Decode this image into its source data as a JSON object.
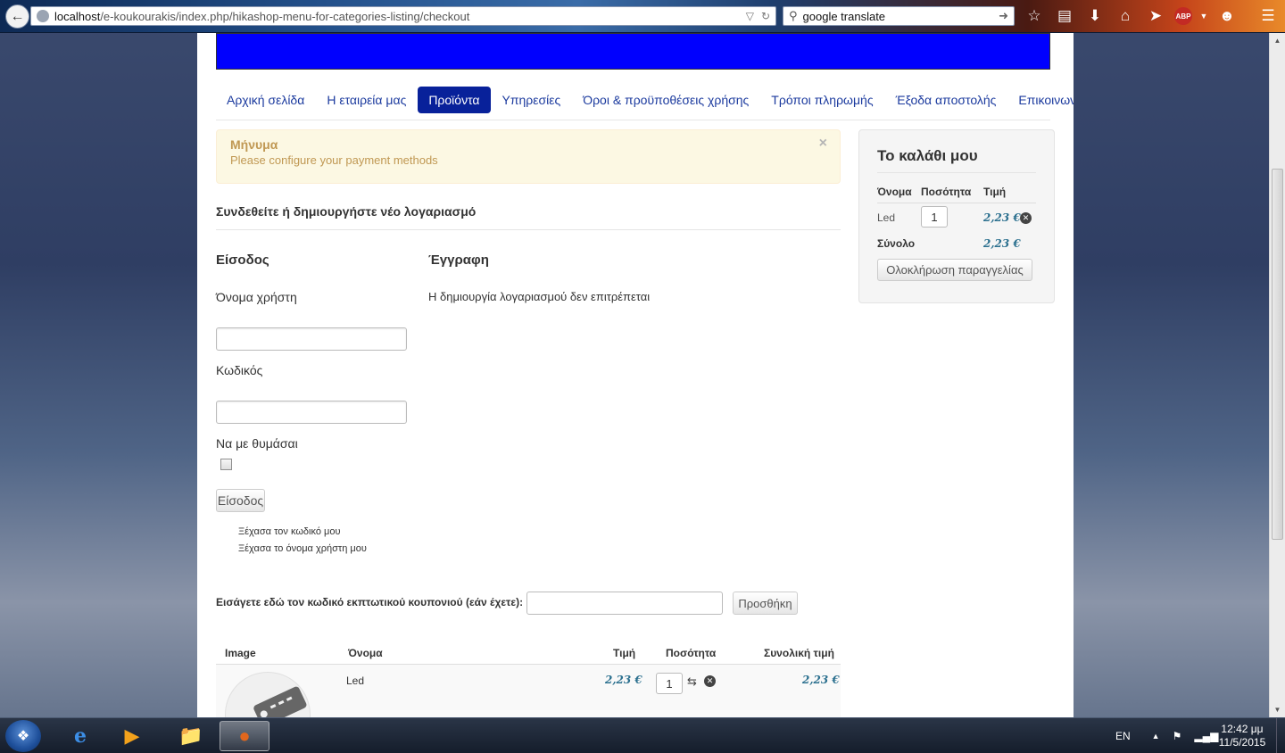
{
  "browser": {
    "url_host": "localhost",
    "url_path": "/e-koukourakis/index.php/hikashop-menu-for-categories-listing/checkout",
    "search_value": "google translate",
    "abp_label": "ABP"
  },
  "nav": {
    "items": [
      {
        "label": "Αρχική σελίδα",
        "active": false
      },
      {
        "label": "Η εταιρεία μας",
        "active": false
      },
      {
        "label": "Προϊόντα",
        "active": true
      },
      {
        "label": "Υπηρεσίες",
        "active": false
      },
      {
        "label": "Όροι & προϋποθέσεις χρήσης",
        "active": false
      },
      {
        "label": "Τρόποι πληρωμής",
        "active": false
      },
      {
        "label": "Έξοδα αποστολής",
        "active": false
      },
      {
        "label": "Επικοινωνία",
        "active": false
      }
    ]
  },
  "alert": {
    "title": "Μήνυμα",
    "message": "Please configure your payment methods",
    "close": "×"
  },
  "login": {
    "heading": "Συνδεθείτε ή δημιουργήστε νέο λογαριασμό",
    "login_title": "Είσοδος",
    "register_title": "Έγγραφη",
    "username_label": "Όνομα χρήστη",
    "password_label": "Κωδικός",
    "remember_label": "Να με θυμάσαι",
    "submit_label": "Είσοδος",
    "forgot_password": "Ξέχασα τον κωδικό μου",
    "forgot_username": "Ξέχασα το όνομα χρήστη μου",
    "register_disabled": "Η δημιουργία λογαριασμού δεν επιτρέπεται"
  },
  "coupon": {
    "label": "Εισάγετε εδώ τον κωδικό εκπτωτικού κουπονιού (εάν έχετε):",
    "button": "Προσθήκη"
  },
  "cart_table": {
    "headers": {
      "image": "Image",
      "name": "Όνομα",
      "price": "Τιμή",
      "qty": "Ποσότητα",
      "total": "Συνολική τιμή"
    },
    "rows": [
      {
        "name": "Led",
        "price": "2,23 €",
        "qty": "1",
        "total": "2,23 €"
      }
    ]
  },
  "mini_cart": {
    "title": "Το καλάθι μου",
    "headers": {
      "name": "Όνομα",
      "qty": "Ποσότητα",
      "price": "Τιμή"
    },
    "item": {
      "name": "Led",
      "qty": "1",
      "price": "2,23 €"
    },
    "total_label": "Σύνολο",
    "total_value": "2,23 €",
    "checkout_button": "Ολοκλήρωση παραγγελίας"
  },
  "taskbar": {
    "lang": "EN",
    "time": "12:42 μμ",
    "date": "11/5/2015"
  },
  "colors": {
    "nav_active": "#08219a",
    "banner": "#0000fe",
    "alert_bg": "#fcf8e3",
    "alert_text": "#c09853",
    "price": "#2a6f8e"
  }
}
